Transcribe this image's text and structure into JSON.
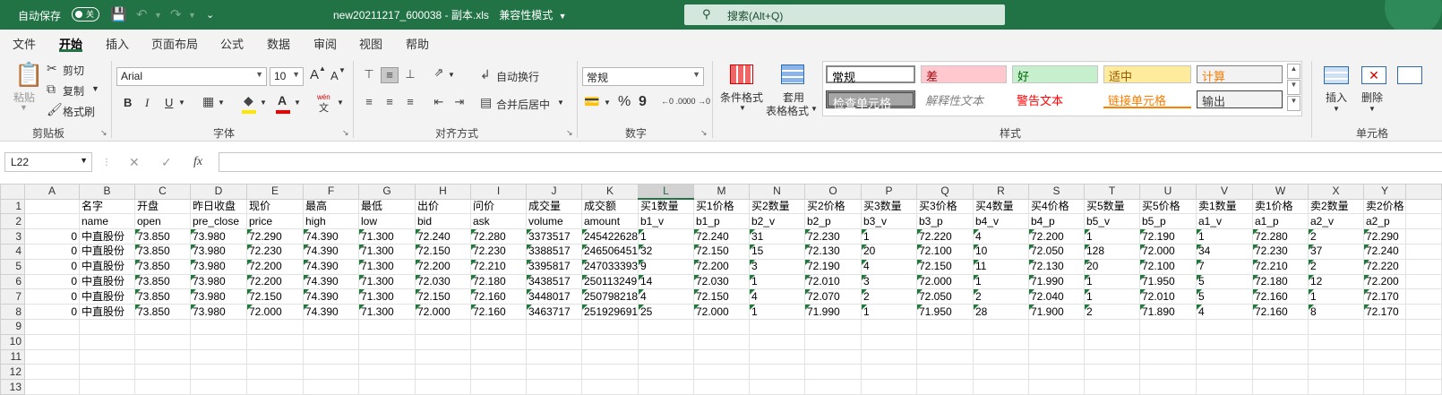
{
  "titlebar": {
    "autosave_label": "自动保存",
    "autosave_state": "关",
    "doc_title": "new20211217_600038 - 副本.xls",
    "mode": "兼容性模式",
    "search_placeholder": "搜索(Alt+Q)",
    "accent": "#217346"
  },
  "menu": {
    "tabs": [
      "文件",
      "开始",
      "插入",
      "页面布局",
      "公式",
      "数据",
      "审阅",
      "视图",
      "帮助"
    ],
    "active": "开始"
  },
  "ribbon": {
    "clipboard": {
      "paste": "粘贴",
      "cut": "剪切",
      "copy": "复制",
      "format_painter": "格式刷",
      "label": "剪贴板"
    },
    "font": {
      "name": "Arial",
      "size": "10",
      "label": "字体",
      "grow": "A",
      "shrink": "A",
      "bold": "B",
      "italic": "I",
      "underline": "U",
      "phonetic": "wén"
    },
    "alignment": {
      "wrap": "自动换行",
      "merge": "合并后居中",
      "label": "对齐方式"
    },
    "number": {
      "format": "常规",
      "label": "数字",
      "percent": "%",
      "comma": "9",
      "inc": "←0 .00",
      "dec": ".00 →0"
    },
    "styles": {
      "conditional": "条件格式",
      "table_line1": "套用",
      "table_line2": "表格格式",
      "items": [
        "常规",
        "差",
        "好",
        "适中",
        "计算",
        "检查单元格",
        "解释性文本",
        "警告文本",
        "链接单元格",
        "输出"
      ],
      "label": "样式"
    },
    "cells": {
      "insert": "插入",
      "delete": "删除",
      "label": "单元格"
    }
  },
  "formula_bar": {
    "name_box": "L22",
    "fx": "fx",
    "value": ""
  },
  "sheet": {
    "columns": [
      "A",
      "B",
      "C",
      "D",
      "E",
      "F",
      "G",
      "H",
      "I",
      "J",
      "K",
      "L",
      "M",
      "N",
      "O",
      "P",
      "Q",
      "R",
      "S",
      "T",
      "U",
      "V",
      "W",
      "X",
      "Y"
    ],
    "selected_column": "L",
    "rows": [
      [
        "",
        "名字",
        "开盘",
        "昨日收盘",
        "现价",
        "最高",
        "最低",
        "出价",
        "问价",
        "成交量",
        "成交额",
        "买1数量",
        "买1价格",
        "买2数量",
        "买2价格",
        "买3数量",
        "买3价格",
        "买4数量",
        "买4价格",
        "买5数量",
        "买5价格",
        "卖1数量",
        "卖1价格",
        "卖2数量",
        "卖2价格"
      ],
      [
        "",
        "name",
        "open",
        "pre_close",
        "price",
        "high",
        "low",
        "bid",
        "ask",
        "volume",
        "amount",
        "b1_v",
        "b1_p",
        "b2_v",
        "b2_p",
        "b3_v",
        "b3_p",
        "b4_v",
        "b4_p",
        "b5_v",
        "b5_p",
        "a1_v",
        "a1_p",
        "a2_v",
        "a2_p"
      ],
      [
        "0",
        "中直股份",
        "73.850",
        "73.980",
        "72.290",
        "74.390",
        "71.300",
        "72.240",
        "72.280",
        "3373517",
        "245422628",
        "1",
        "72.240",
        "31",
        "72.230",
        "1",
        "72.220",
        "4",
        "72.200",
        "1",
        "72.190",
        "1",
        "72.280",
        "2",
        "72.290"
      ],
      [
        "0",
        "中直股份",
        "73.850",
        "73.980",
        "72.230",
        "74.390",
        "71.300",
        "72.150",
        "72.230",
        "3388517",
        "246506451",
        "32",
        "72.150",
        "15",
        "72.130",
        "20",
        "72.100",
        "10",
        "72.050",
        "128",
        "72.000",
        "34",
        "72.230",
        "37",
        "72.240"
      ],
      [
        "0",
        "中直股份",
        "73.850",
        "73.980",
        "72.200",
        "74.390",
        "71.300",
        "72.200",
        "72.210",
        "3395817",
        "247033393",
        "9",
        "72.200",
        "3",
        "72.190",
        "4",
        "72.150",
        "11",
        "72.130",
        "20",
        "72.100",
        "7",
        "72.210",
        "2",
        "72.220"
      ],
      [
        "0",
        "中直股份",
        "73.850",
        "73.980",
        "72.200",
        "74.390",
        "71.300",
        "72.030",
        "72.180",
        "3438517",
        "250113249",
        "14",
        "72.030",
        "1",
        "72.010",
        "3",
        "72.000",
        "1",
        "71.990",
        "1",
        "71.950",
        "5",
        "72.180",
        "12",
        "72.200"
      ],
      [
        "0",
        "中直股份",
        "73.850",
        "73.980",
        "72.150",
        "74.390",
        "71.300",
        "72.150",
        "72.160",
        "3448017",
        "250798218",
        "4",
        "72.150",
        "4",
        "72.070",
        "2",
        "72.050",
        "2",
        "72.040",
        "1",
        "72.010",
        "5",
        "72.160",
        "1",
        "72.170"
      ],
      [
        "0",
        "中直股份",
        "73.850",
        "73.980",
        "72.000",
        "74.390",
        "71.300",
        "72.000",
        "72.160",
        "3463717",
        "251929691",
        "25",
        "72.000",
        "1",
        "71.990",
        "1",
        "71.950",
        "28",
        "71.900",
        "2",
        "71.890",
        "4",
        "72.160",
        "8",
        "72.170"
      ],
      [
        "",
        "",
        "",
        "",
        "",
        "",
        "",
        "",
        "",
        "",
        "",
        "",
        "",
        "",
        "",
        "",
        "",
        "",
        "",
        "",
        "",
        "",
        "",
        "",
        ""
      ],
      [
        "",
        "",
        "",
        "",
        "",
        "",
        "",
        "",
        "",
        "",
        "",
        "",
        "",
        "",
        "",
        "",
        "",
        "",
        "",
        "",
        "",
        "",
        "",
        "",
        ""
      ],
      [
        "",
        "",
        "",
        "",
        "",
        "",
        "",
        "",
        "",
        "",
        "",
        "",
        "",
        "",
        "",
        "",
        "",
        "",
        "",
        "",
        "",
        "",
        "",
        "",
        ""
      ],
      [
        "",
        "",
        "",
        "",
        "",
        "",
        "",
        "",
        "",
        "",
        "",
        "",
        "",
        "",
        "",
        "",
        "",
        "",
        "",
        "",
        "",
        "",
        "",
        "",
        ""
      ],
      [
        "",
        "",
        "",
        "",
        "",
        "",
        "",
        "",
        "",
        "",
        "",
        "",
        "",
        "",
        "",
        "",
        "",
        "",
        "",
        "",
        "",
        "",
        "",
        "",
        ""
      ]
    ]
  }
}
